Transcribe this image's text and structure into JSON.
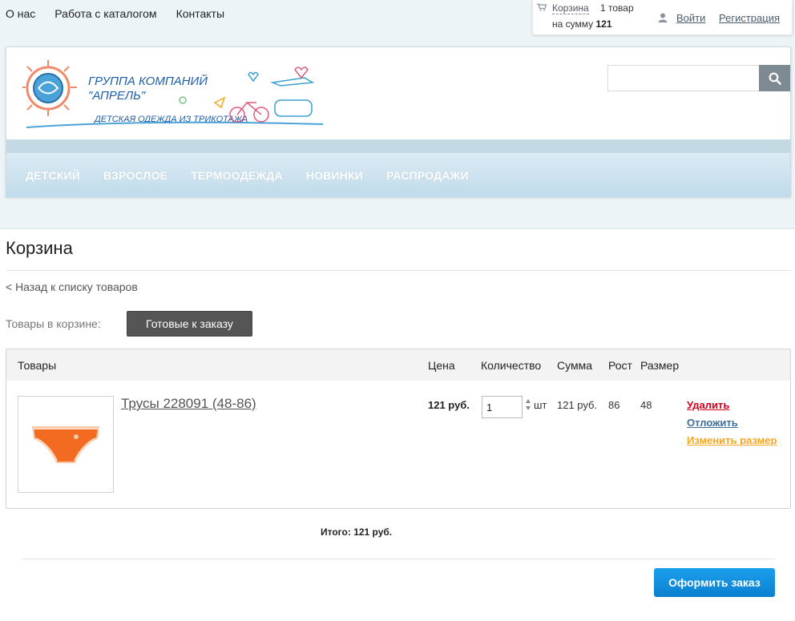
{
  "topnav": {
    "items": [
      "О нас",
      "Работа с каталогом",
      "Контакты"
    ]
  },
  "cart_widget": {
    "link": "Корзина",
    "count": "1 товар",
    "sum_prefix": "на сумму",
    "sum_value": "121",
    "icon": "cart-icon"
  },
  "auth": {
    "login": "Войти",
    "register": "Регистрация",
    "icon": "user-icon"
  },
  "logo": {
    "line1": "ГРУППА КОМПАНИЙ",
    "line2": "\"АПРЕЛЬ\"",
    "tagline": "ДЕТСКАЯ ОДЕЖДА ИЗ ТРИКОТАЖА"
  },
  "search": {
    "placeholder": "",
    "icon": "search-icon"
  },
  "menu": {
    "items": [
      "Детский",
      "Взрослое",
      "Термоодежда",
      "Новинки",
      "Распродажи"
    ]
  },
  "page": {
    "title": "Корзина",
    "back_link": "< Назад к списку товаров",
    "tabs_label": "Товары в корзине:",
    "tab_ready": "Готовые к заказу"
  },
  "table": {
    "headers": {
      "goods": "Товары",
      "price": "Цена",
      "quantity": "Количество",
      "sum": "Сумма",
      "height": "Рост",
      "size": "Размер"
    },
    "rows": [
      {
        "name": "Трусы 228091 (48-86)",
        "price": "121 руб.",
        "quantity": "1",
        "unit": "шт",
        "sum": "121 руб.",
        "height": "86",
        "size": "48",
        "actions": {
          "delete": "Удалить",
          "postpone": "Отложить",
          "change_size": "Изменить размер"
        }
      }
    ]
  },
  "total": {
    "label": "Итого:",
    "value": "121 руб."
  },
  "order_button": "Оформить заказ",
  "colors": {
    "accent_blue": "#0b7fcf",
    "delete_red": "#d0021b",
    "postpone_blue": "#3a6f9a",
    "change_orange": "#f5a623",
    "menu_bg": "#c0dbea"
  }
}
